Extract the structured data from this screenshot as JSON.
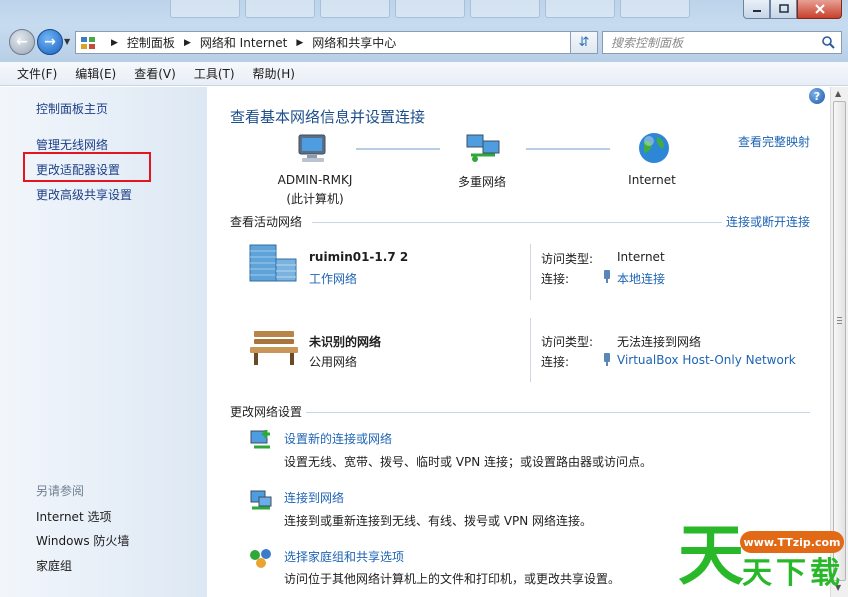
{
  "address": {
    "breadcrumbs": [
      "控制面板",
      "网络和 Internet",
      "网络和共享中心"
    ]
  },
  "search": {
    "placeholder": "搜索控制面板"
  },
  "menu": [
    "文件(F)",
    "编辑(E)",
    "查看(V)",
    "工具(T)",
    "帮助(H)"
  ],
  "sidebar": {
    "home": "控制面板主页",
    "links": [
      "管理无线网络",
      "更改适配器设置",
      "更改高级共享设置"
    ],
    "see_also_title": "另请参阅",
    "see_also": [
      "Internet 选项",
      "Windows 防火墙",
      "家庭组"
    ]
  },
  "main": {
    "title": "查看基本网络信息并设置连接",
    "full_map": "查看完整映射",
    "map": {
      "computer_name": "ADMIN-RMKJ",
      "computer_sub": "(此计算机)",
      "middle": "多重网络",
      "internet": "Internet"
    },
    "active_title": "查看活动网络",
    "connect_disconnect": "连接或断开连接",
    "networks": [
      {
        "name": "ruimin01-1.7  2",
        "type_link": "工作网络",
        "access_label": "访问类型:",
        "access_value": "Internet",
        "conn_label": "连接:",
        "conn_value": "本地连接"
      },
      {
        "name": "未识别的网络",
        "type": "公用网络",
        "access_label": "访问类型:",
        "access_value": "无法连接到网络",
        "conn_label": "连接:",
        "conn_value": "VirtualBox Host-Only Network"
      }
    ],
    "change_title": "更改网络设置",
    "tasks": [
      {
        "link": "设置新的连接或网络",
        "desc": "设置无线、宽带、拨号、临时或 VPN 连接；或设置路由器或访问点。"
      },
      {
        "link": "连接到网络",
        "desc": "连接到或重新连接到无线、有线、拨号或 VPN 网络连接。"
      },
      {
        "link": "选择家庭组和共享选项",
        "desc": "访问位于其他网络计算机上的文件和打印机，或更改共享设置。"
      }
    ]
  },
  "watermark": {
    "big": "天",
    "url": "www.TTzip.com",
    "small": [
      "天",
      "下",
      "载"
    ]
  },
  "colors": {
    "link": "#1e64b4",
    "heading": "#1c4d8d",
    "highlight": "#e3161f",
    "watermark_green": "#2ab82b",
    "watermark_orange": "#e26a17"
  }
}
